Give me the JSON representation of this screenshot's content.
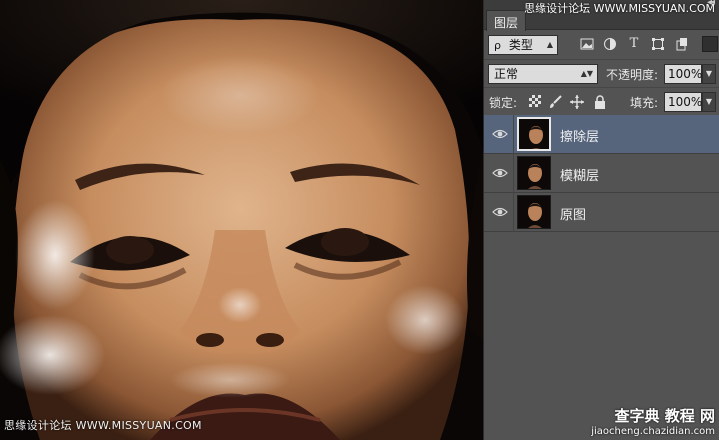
{
  "watermarks": {
    "top": "思缘设计论坛 WWW.MISSYUAN.COM",
    "left": "思缘设计论坛 WWW.MISSYUAN.COM",
    "bottom_main": "查字典 教程 网",
    "bottom_sub": "jiaocheng.chazidian.com"
  },
  "panel": {
    "tab_label": "图层",
    "collapse_glyph": "◂◂",
    "filter": {
      "kind_label": "类型",
      "search_glyph": "ρ"
    },
    "filter_icons": [
      "image-filter-icon",
      "adjustment-filter-icon",
      "type-filter-icon",
      "shape-filter-icon",
      "smart-object-filter-icon"
    ],
    "blend_mode": "正常",
    "opacity_label": "不透明度:",
    "opacity_value": "100%",
    "lock_label": "锁定:",
    "fill_label": "填充:",
    "fill_value": "100%",
    "type_icon_glyph": "T"
  },
  "layers": [
    {
      "name": "擦除层",
      "visible": true,
      "selected": true
    },
    {
      "name": "模糊层",
      "visible": true,
      "selected": false
    },
    {
      "name": "原图",
      "visible": true,
      "selected": false
    }
  ],
  "colors": {
    "panel_bg": "#535353",
    "selected_layer": "#57657c",
    "panel_header": "#3c3c3c"
  }
}
